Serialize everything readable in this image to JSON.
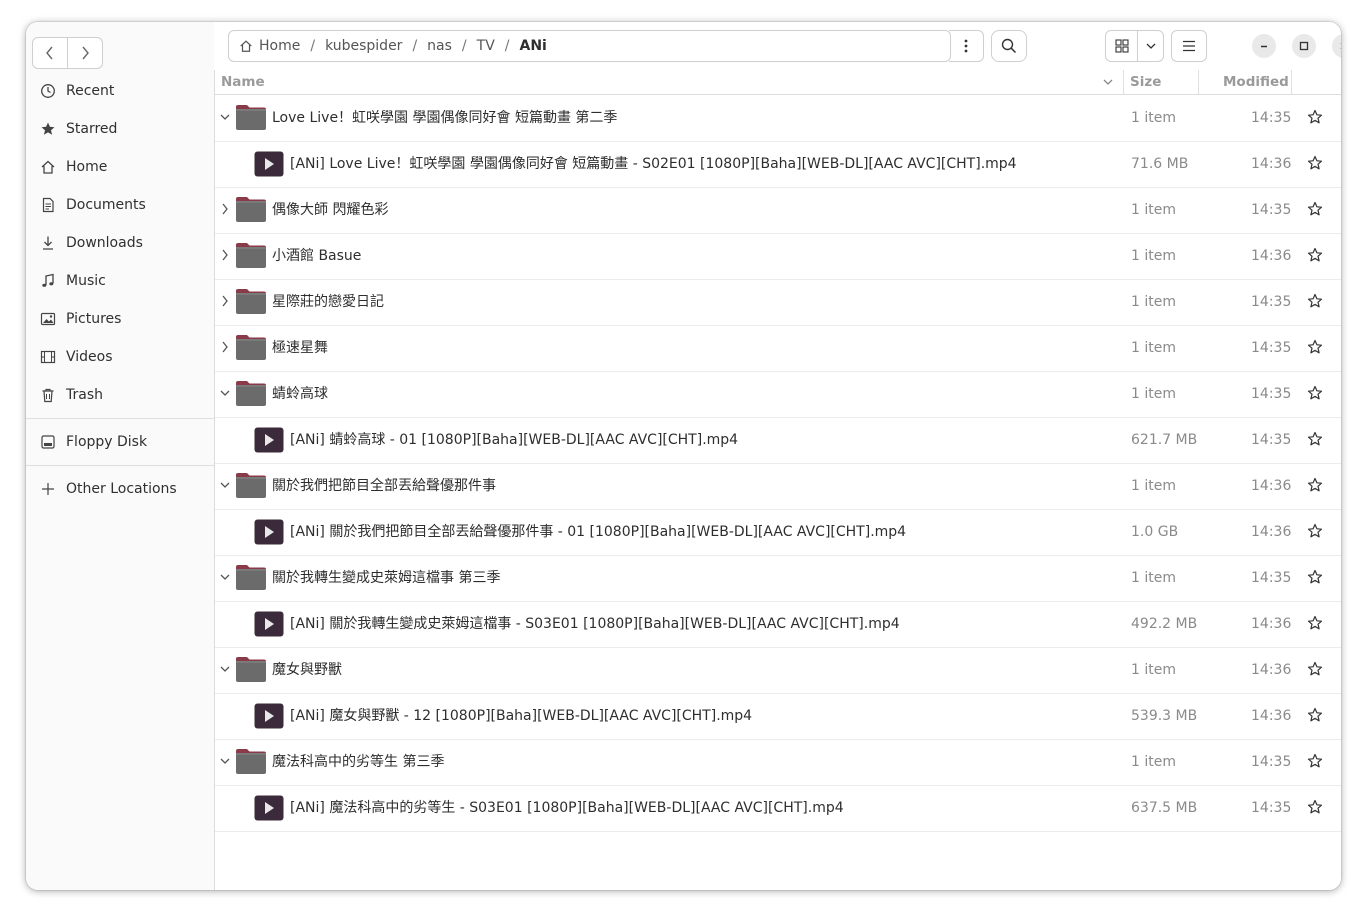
{
  "sidebar": {
    "items": [
      {
        "label": "Recent",
        "icon": "clock-icon"
      },
      {
        "label": "Starred",
        "icon": "star-icon"
      },
      {
        "label": "Home",
        "icon": "home-icon"
      },
      {
        "label": "Documents",
        "icon": "document-icon"
      },
      {
        "label": "Downloads",
        "icon": "download-icon"
      },
      {
        "label": "Music",
        "icon": "music-icon"
      },
      {
        "label": "Pictures",
        "icon": "picture-icon"
      },
      {
        "label": "Videos",
        "icon": "video-icon"
      },
      {
        "label": "Trash",
        "icon": "trash-icon"
      }
    ],
    "devices": [
      {
        "label": "Floppy Disk",
        "icon": "disk-icon"
      }
    ],
    "other": {
      "label": "Other Locations",
      "icon": "plus-icon"
    }
  },
  "breadcrumb": {
    "home": "Home",
    "parts": [
      "kubespider",
      "nas",
      "TV"
    ],
    "current": "ANi"
  },
  "columns": {
    "name": "Name",
    "size": "Size",
    "modified": "Modified"
  },
  "rows": [
    {
      "type": "folder",
      "expanded": true,
      "name": "Love Live！虹咲學園 學園偶像同好會 短篇動畫 第二季",
      "size": "1 item",
      "modified": "14:35"
    },
    {
      "type": "video",
      "name": "[ANi] Love Live！虹咲學園 學園偶像同好會 短篇動畫 - S02E01 [1080P][Baha][WEB-DL][AAC AVC][CHT].mp4",
      "size": "71.6 MB",
      "modified": "14:36"
    },
    {
      "type": "folder",
      "expanded": false,
      "name": "偶像大師 閃耀色彩",
      "size": "1 item",
      "modified": "14:35"
    },
    {
      "type": "folder",
      "expanded": false,
      "name": "小酒館 Basue",
      "size": "1 item",
      "modified": "14:36"
    },
    {
      "type": "folder",
      "expanded": false,
      "name": "星際莊的戀愛日記",
      "size": "1 item",
      "modified": "14:35"
    },
    {
      "type": "folder",
      "expanded": false,
      "name": "極速星舞",
      "size": "1 item",
      "modified": "14:35"
    },
    {
      "type": "folder",
      "expanded": true,
      "name": "蜻蛉高球",
      "size": "1 item",
      "modified": "14:35"
    },
    {
      "type": "video",
      "name": "[ANi] 蜻蛉高球 - 01 [1080P][Baha][WEB-DL][AAC AVC][CHT].mp4",
      "size": "621.7 MB",
      "modified": "14:35"
    },
    {
      "type": "folder",
      "expanded": true,
      "name": "關於我們把節目全部丟給聲優那件事",
      "size": "1 item",
      "modified": "14:36"
    },
    {
      "type": "video",
      "name": "[ANi] 關於我們把節目全部丟給聲優那件事 - 01 [1080P][Baha][WEB-DL][AAC AVC][CHT].mp4",
      "size": "1.0 GB",
      "modified": "14:36"
    },
    {
      "type": "folder",
      "expanded": true,
      "name": "關於我轉生變成史萊姆這檔事 第三季",
      "size": "1 item",
      "modified": "14:35"
    },
    {
      "type": "video",
      "name": "[ANi] 關於我轉生變成史萊姆這檔事 - S03E01 [1080P][Baha][WEB-DL][AAC AVC][CHT].mp4",
      "size": "492.2 MB",
      "modified": "14:36"
    },
    {
      "type": "folder",
      "expanded": true,
      "name": "魔女與野獸",
      "size": "1 item",
      "modified": "14:36"
    },
    {
      "type": "video",
      "name": "[ANi] 魔女與野獸 - 12 [1080P][Baha][WEB-DL][AAC AVC][CHT].mp4",
      "size": "539.3 MB",
      "modified": "14:36"
    },
    {
      "type": "folder",
      "expanded": true,
      "name": "魔法科高中的劣等生 第三季",
      "size": "1 item",
      "modified": "14:35"
    },
    {
      "type": "video",
      "name": "[ANi] 魔法科高中的劣等生 - S03E01 [1080P][Baha][WEB-DL][AAC AVC][CHT].mp4",
      "size": "637.5 MB",
      "modified": "14:35"
    }
  ],
  "colors": {
    "folder": "#6b6b6b",
    "folder_tab": "#8a3b4a",
    "video_bg": "#3b2a3a",
    "accent": "#e95420"
  }
}
